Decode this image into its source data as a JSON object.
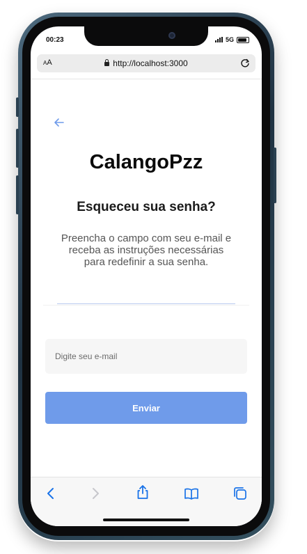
{
  "status_bar": {
    "time": "00:23",
    "network": "5G"
  },
  "browser": {
    "text_size_button": {
      "small": "A",
      "large": "A"
    },
    "url": "http://localhost:3000",
    "icons": {
      "lock": "lock-icon",
      "reload": "reload-icon",
      "back": "chevron-left-icon",
      "forward": "chevron-right-icon",
      "share": "share-icon",
      "bookmarks": "book-icon",
      "tabs": "tabs-icon"
    }
  },
  "page": {
    "back_icon": "arrow-left-icon",
    "brand": "CalangoPzz",
    "heading": "Esqueceu sua senha?",
    "instructions": "Preencha o campo com seu e-mail e receba as instruções necessárias para redefinir a sua senha.",
    "email": {
      "placeholder": "Digite seu e-mail",
      "value": ""
    },
    "submit_label": "Enviar"
  },
  "colors": {
    "accent": "#6f9bea",
    "browser_blue": "#1a73e8",
    "disabled": "#c7c7cc",
    "input_bg": "#f6f6f6"
  }
}
